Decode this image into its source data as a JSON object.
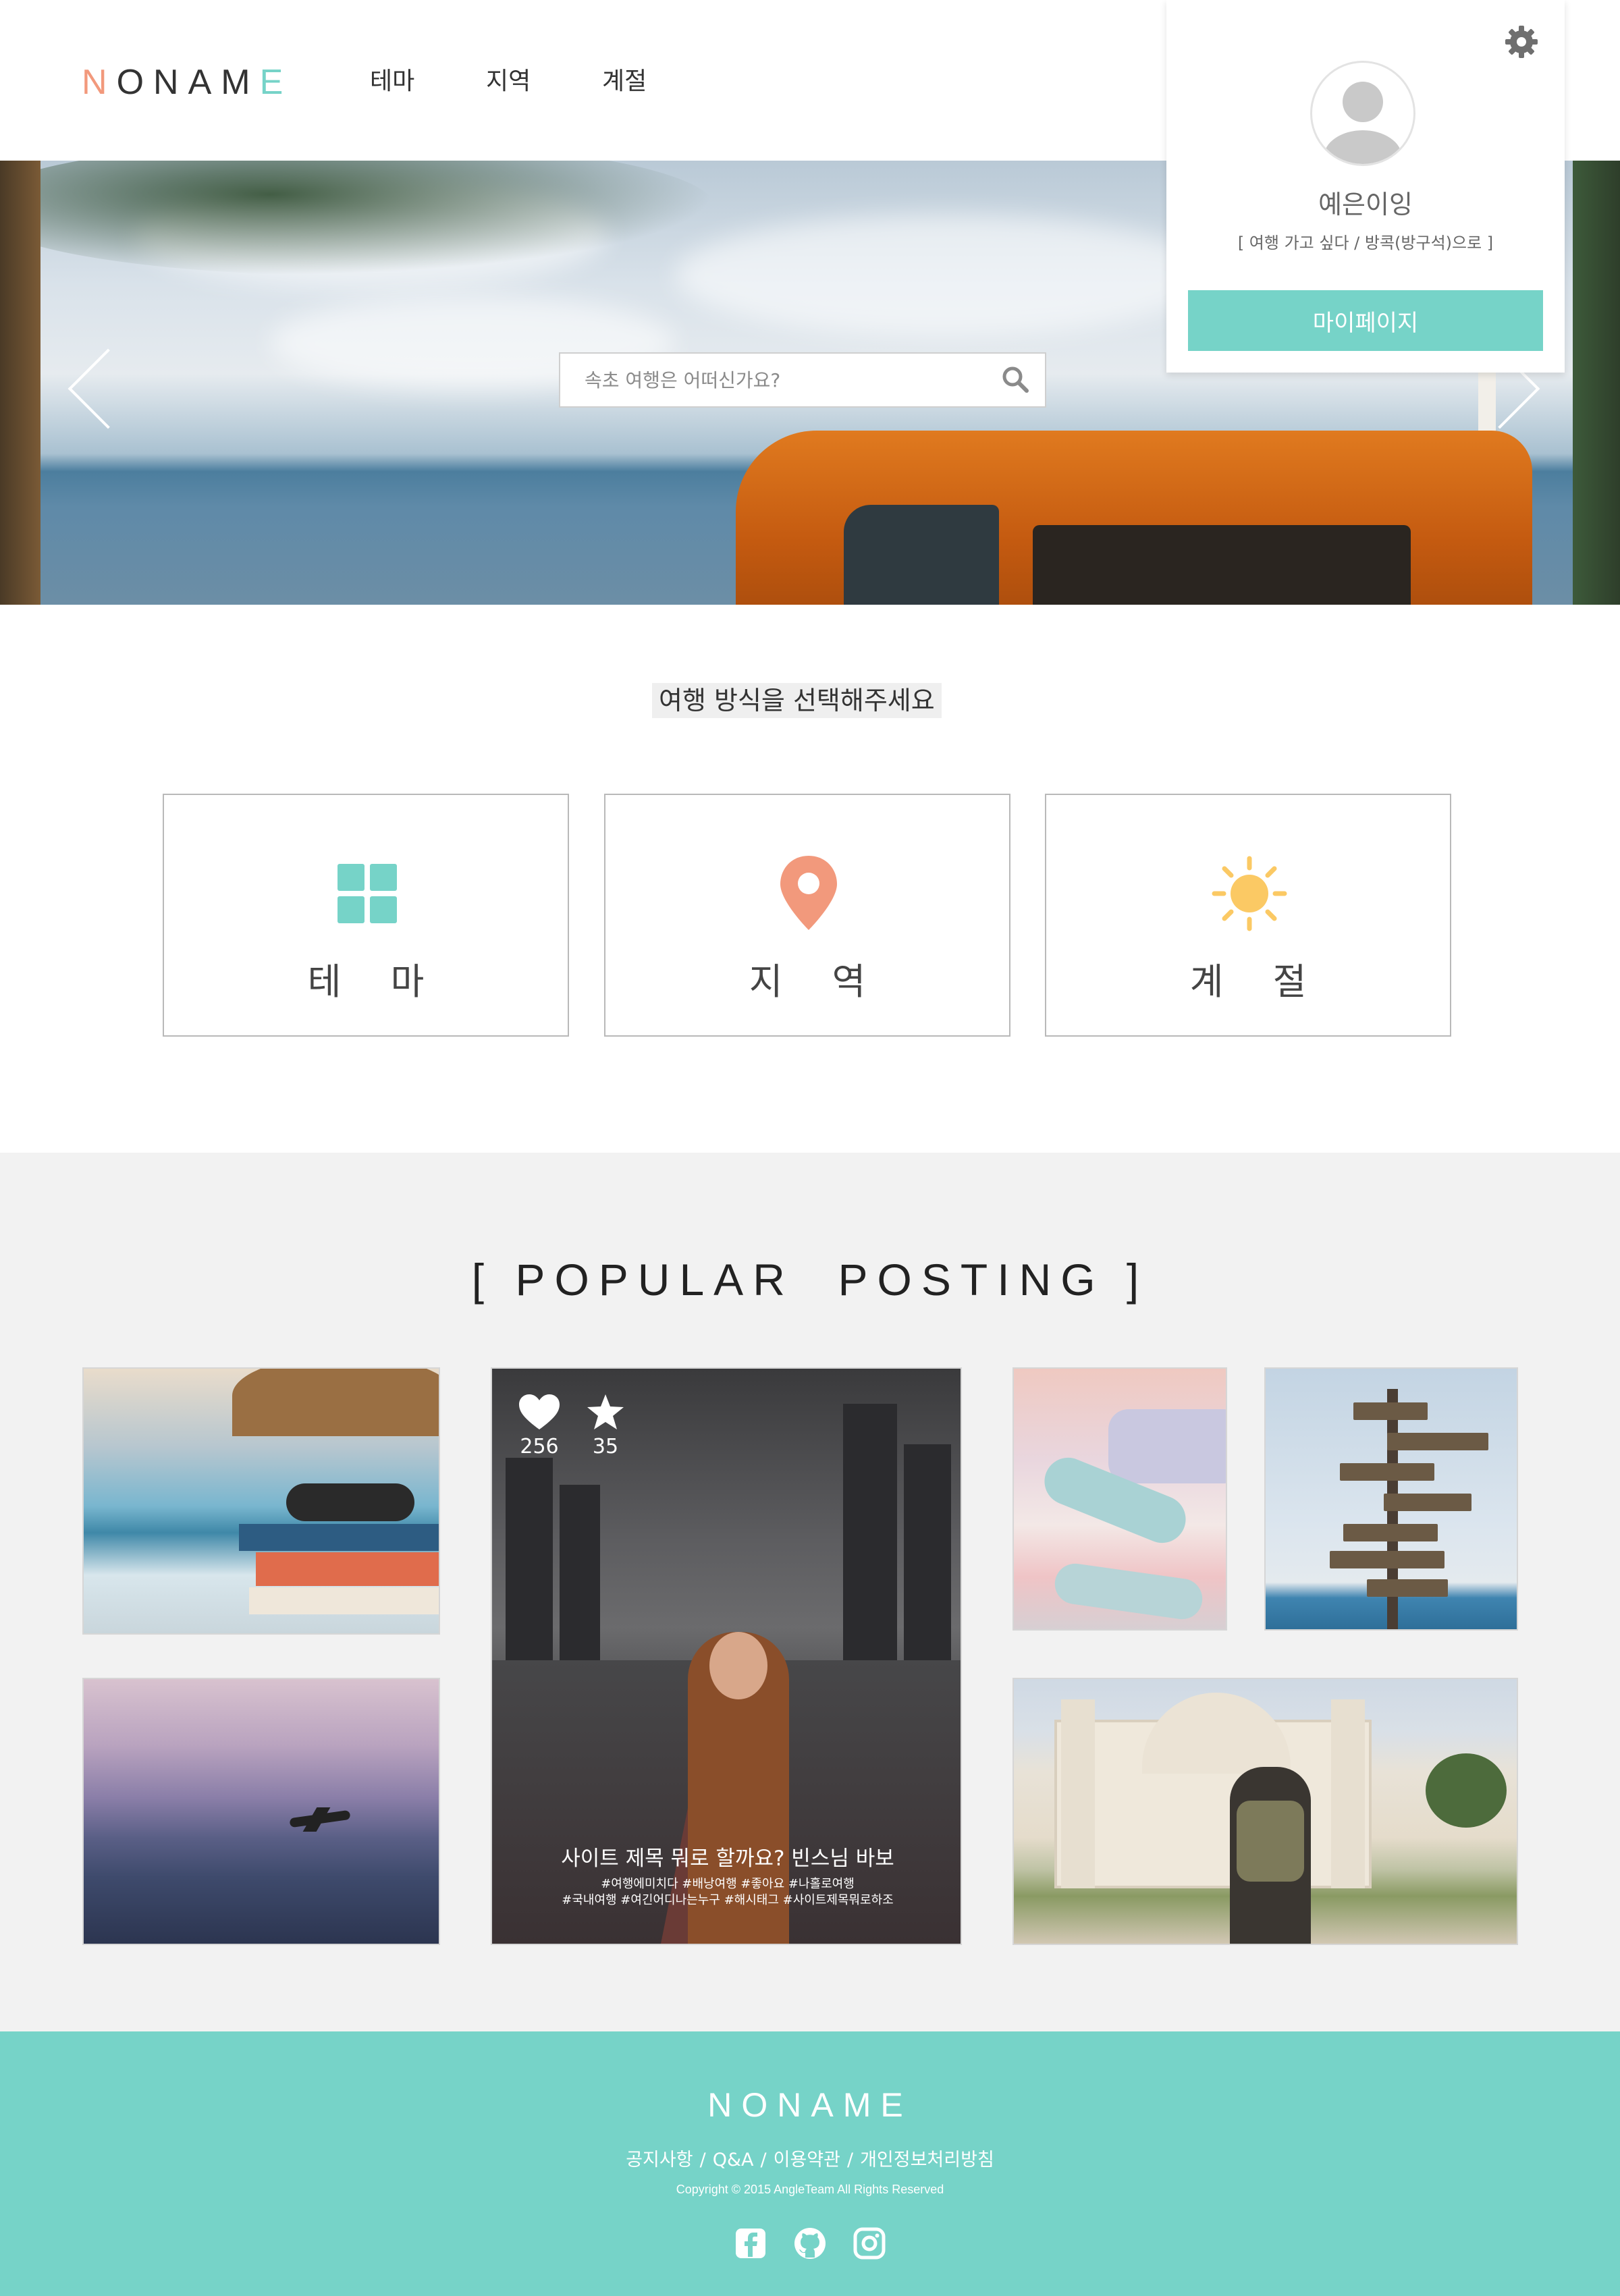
{
  "brand": {
    "logo_letters": [
      "N",
      "O",
      "N",
      "A",
      "M",
      "E"
    ],
    "logo_colors": [
      "#f2997c",
      "#333333",
      "#333333",
      "#333333",
      "#333333",
      "#76d3c8"
    ],
    "accent": "#76d3c8",
    "accent_orange": "#f2997c",
    "accent_yellow": "#fbc964"
  },
  "nav": {
    "items": [
      {
        "label": "테마"
      },
      {
        "label": "지역"
      },
      {
        "label": "계절"
      }
    ]
  },
  "hero": {
    "search": {
      "placeholder": "속초 여행은 어떠신가요?",
      "icon": "search-icon"
    },
    "prev_icon": "chevron-left-icon",
    "next_icon": "chevron-right-icon"
  },
  "profile": {
    "settings_icon": "gear-icon",
    "avatar_icon": "user-silhouette-icon",
    "username": "예은이잉",
    "status": "[ 여행 가고 싶다 / 방콕(방구석)으로 ]",
    "mypage_label": "마이페이지"
  },
  "travel_select": {
    "title": "여행 방식을 선택해주세요",
    "cards": [
      {
        "label": "테 마",
        "icon": "grid-icon",
        "color": "#76d3c8"
      },
      {
        "label": "지 역",
        "icon": "location-pin-icon",
        "color": "#f2997c"
      },
      {
        "label": "계 절",
        "icon": "sun-icon",
        "color": "#fbc964"
      }
    ]
  },
  "popular": {
    "title": "[ POPULAR  POSTING ]",
    "featured": {
      "likes": "256",
      "stars": "35",
      "title": "사이트 제목 뭐로 할까요? 빈스님 바보",
      "tags_line1": "#여행에미치다 #배낭여행 #좋아요 #나홀로여행",
      "tags_line2": "#국내여행 #여긴어디나는누구 #해시태그 #사이트제목뭐로하조"
    }
  },
  "footer": {
    "logo": "NONAME",
    "links": [
      "공지사항",
      "Q&A",
      "이용약관",
      "개인정보처리방침"
    ],
    "link_separator": "/",
    "copyright": "Copyright © 2015 AngleTeam All Rights Reserved",
    "social_icons": [
      "facebook-icon",
      "github-icon",
      "instagram-icon"
    ]
  }
}
